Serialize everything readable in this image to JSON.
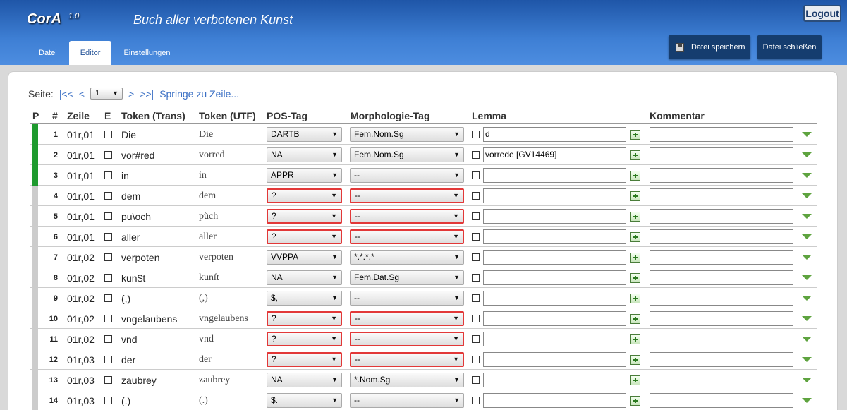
{
  "app": {
    "name": "CorA",
    "version": "1.0",
    "document_title": "Buch aller verbotenen Kunst",
    "logout_label": "Logout"
  },
  "tabs": [
    {
      "label": "Datei"
    },
    {
      "label": "Editor",
      "active": true
    },
    {
      "label": "Einstellungen"
    }
  ],
  "header_buttons": {
    "save_label": "Datei speichern",
    "close_label": "Datei schließen"
  },
  "pager": {
    "label": "Seite:",
    "first": "|<<",
    "prev": "<",
    "page": "1",
    "next": ">",
    "last": ">>|",
    "jump": "Springe zu Zeile..."
  },
  "columns": {
    "p": "P",
    "num": "#",
    "zeile": "Zeile",
    "e": "E",
    "token_trans": "Token (Trans)",
    "token_utf": "Token (UTF)",
    "pos": "POS-Tag",
    "morph": "Morphologie-Tag",
    "lemma": "Lemma",
    "kommentar": "Kommentar"
  },
  "colors": {
    "header_blue": "#2f6cc0",
    "progress_green": "#1e9a2e",
    "error_red": "#e23838"
  },
  "rows": [
    {
      "num": "1",
      "zeile": "01r,01",
      "trans": "Die",
      "utf": "Die",
      "pos": "DARTB",
      "morph": "Fem.Nom.Sg",
      "lemma": "d",
      "done": true,
      "error": false
    },
    {
      "num": "2",
      "zeile": "01r,01",
      "trans": "vor#red",
      "utf": "vorred",
      "pos": "NA",
      "morph": "Fem.Nom.Sg",
      "lemma": "vorrede [GV14469]",
      "done": true,
      "error": false
    },
    {
      "num": "3",
      "zeile": "01r,01",
      "trans": "in",
      "utf": "in",
      "pos": "APPR",
      "morph": "--",
      "lemma": "",
      "done": true,
      "error": false
    },
    {
      "num": "4",
      "zeile": "01r,01",
      "trans": "dem",
      "utf": "dem",
      "pos": "?",
      "morph": "--",
      "lemma": "",
      "done": false,
      "error": true
    },
    {
      "num": "5",
      "zeile": "01r,01",
      "trans": "pu\\och",
      "utf": "půch",
      "pos": "?",
      "morph": "--",
      "lemma": "",
      "done": false,
      "error": true
    },
    {
      "num": "6",
      "zeile": "01r,01",
      "trans": "aller",
      "utf": "aller",
      "pos": "?",
      "morph": "--",
      "lemma": "",
      "done": false,
      "error": true
    },
    {
      "num": "7",
      "zeile": "01r,02",
      "trans": "verpoten",
      "utf": "verpoten",
      "pos": "VVPPA",
      "morph": "*.*.*.*",
      "lemma": "",
      "done": false,
      "error": false
    },
    {
      "num": "8",
      "zeile": "01r,02",
      "trans": "kun$t",
      "utf": "kunſt",
      "pos": "NA",
      "morph": "Fem.Dat.Sg",
      "lemma": "",
      "done": false,
      "error": false
    },
    {
      "num": "9",
      "zeile": "01r,02",
      "trans": "(,)",
      "utf": "(,)",
      "pos": "$,",
      "morph": "--",
      "lemma": "",
      "done": false,
      "error": false
    },
    {
      "num": "10",
      "zeile": "01r,02",
      "trans": "vngelaubens",
      "utf": "vngelaubens",
      "pos": "?",
      "morph": "--",
      "lemma": "",
      "done": false,
      "error": true
    },
    {
      "num": "11",
      "zeile": "01r,02",
      "trans": "vnd",
      "utf": "vnd",
      "pos": "?",
      "morph": "--",
      "lemma": "",
      "done": false,
      "error": true
    },
    {
      "num": "12",
      "zeile": "01r,03",
      "trans": "der",
      "utf": "der",
      "pos": "?",
      "morph": "--",
      "lemma": "",
      "done": false,
      "error": true
    },
    {
      "num": "13",
      "zeile": "01r,03",
      "trans": "zaubrey",
      "utf": "zaubrey",
      "pos": "NA",
      "morph": "*.Nom.Sg",
      "lemma": "",
      "done": false,
      "error": false
    },
    {
      "num": "14",
      "zeile": "01r,03",
      "trans": "(.)",
      "utf": "(.)",
      "pos": "$.",
      "morph": "--",
      "lemma": "",
      "done": false,
      "error": false
    }
  ]
}
